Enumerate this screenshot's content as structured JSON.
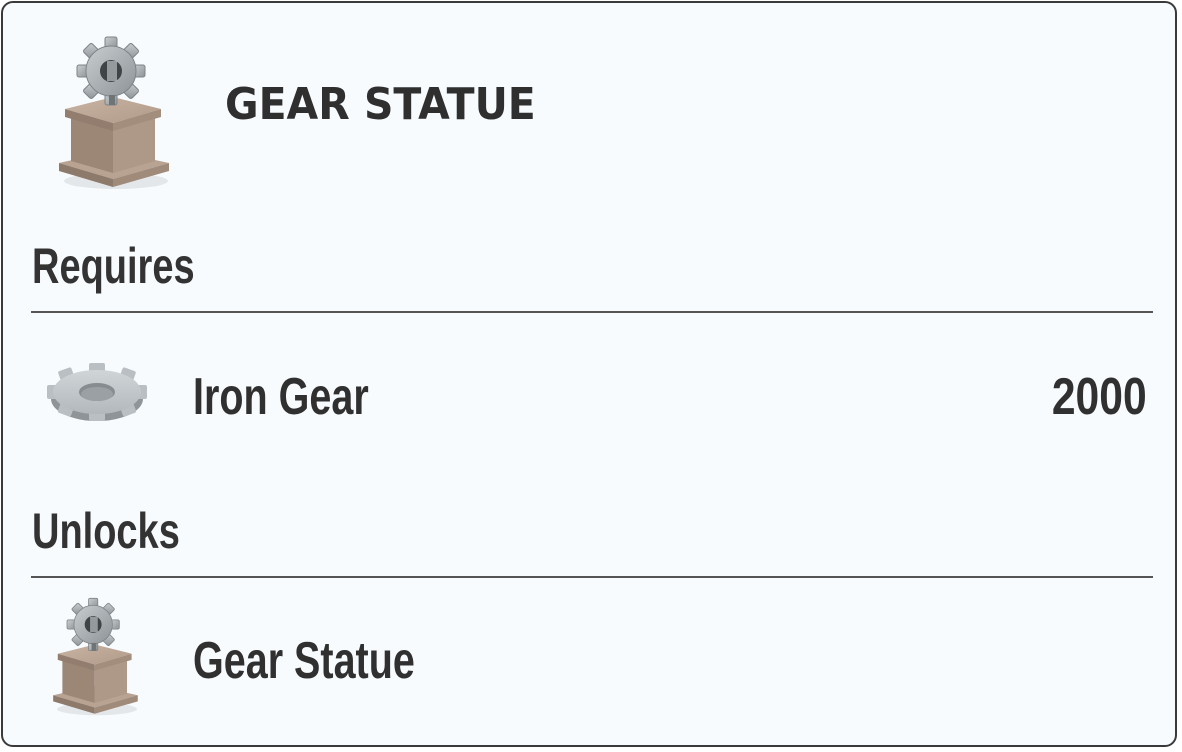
{
  "header": {
    "title": "GEAR STATUE",
    "icon": "gear-statue-icon"
  },
  "requires": {
    "heading": "Requires",
    "items": [
      {
        "label": "Iron Gear",
        "quantity": "2000",
        "icon": "iron-gear-icon"
      }
    ]
  },
  "unlocks": {
    "heading": "Unlocks",
    "items": [
      {
        "label": "Gear Statue",
        "icon": "gear-statue-icon"
      }
    ]
  },
  "colors": {
    "background": "#f7fbfe",
    "border": "#3a3a3a",
    "text": "#303030",
    "pedestal": "#a89282",
    "gear": "#a9afb3"
  }
}
